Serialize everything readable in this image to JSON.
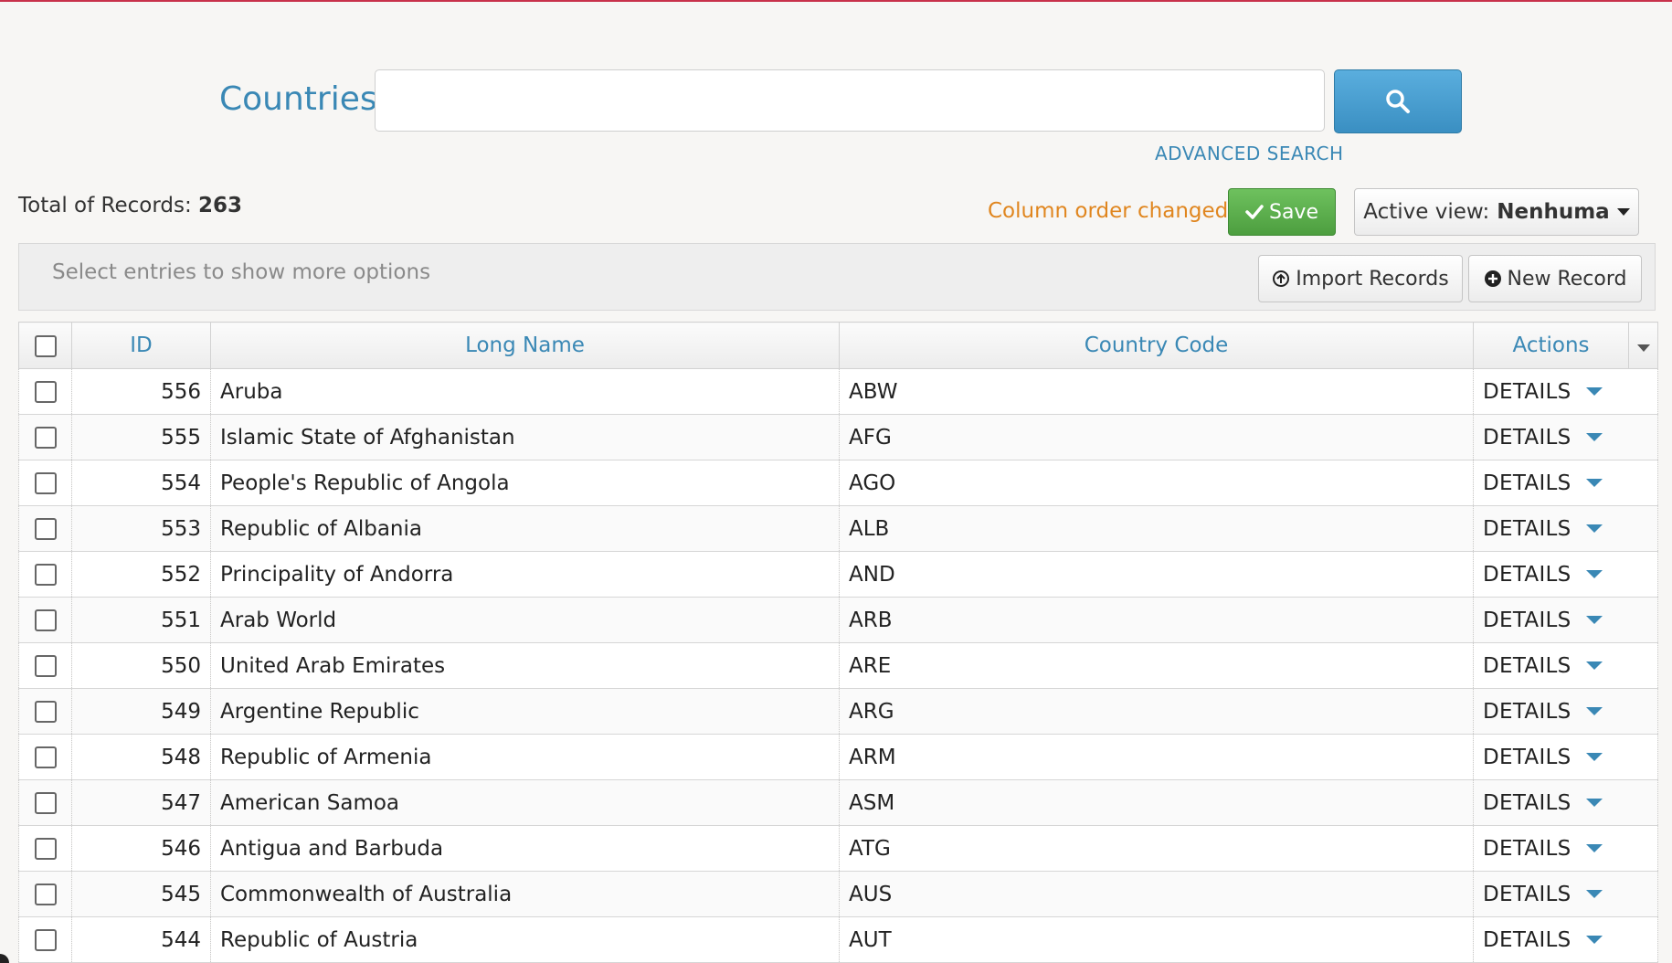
{
  "search": {
    "title": "Countries",
    "value": "",
    "placeholder": "",
    "advanced_label": "ADVANCED SEARCH"
  },
  "summary": {
    "total_label": "Total of Records:",
    "total_value": "263",
    "column_order_notice": "Column order changed",
    "save_label": "Save",
    "active_view_label": "Active view:",
    "active_view_name": "Nenhuma"
  },
  "options": {
    "hint": "Select entries to show more options",
    "import_label": "Import Records",
    "new_label": "New Record"
  },
  "table": {
    "columns": [
      "ID",
      "Long Name",
      "Country Code",
      "Actions"
    ],
    "action_label": "DETAILS",
    "rows": [
      {
        "id": "556",
        "long_name": "Aruba",
        "code": "ABW"
      },
      {
        "id": "555",
        "long_name": "Islamic State of Afghanistan",
        "code": "AFG"
      },
      {
        "id": "554",
        "long_name": "People's Republic of Angola",
        "code": "AGO"
      },
      {
        "id": "553",
        "long_name": "Republic of Albania",
        "code": "ALB"
      },
      {
        "id": "552",
        "long_name": "Principality of Andorra",
        "code": "AND"
      },
      {
        "id": "551",
        "long_name": "Arab World",
        "code": "ARB"
      },
      {
        "id": "550",
        "long_name": "United Arab Emirates",
        "code": "ARE"
      },
      {
        "id": "549",
        "long_name": "Argentine Republic",
        "code": "ARG"
      },
      {
        "id": "548",
        "long_name": "Republic of Armenia",
        "code": "ARM"
      },
      {
        "id": "547",
        "long_name": "American Samoa",
        "code": "ASM"
      },
      {
        "id": "546",
        "long_name": "Antigua and Barbuda",
        "code": "ATG"
      },
      {
        "id": "545",
        "long_name": "Commonwealth of Australia",
        "code": "AUS"
      },
      {
        "id": "544",
        "long_name": "Republic of Austria",
        "code": "AUT"
      }
    ]
  },
  "colors": {
    "accent": "#3a88b5",
    "save_green": "#5cb04d",
    "notice_orange": "#e0861f",
    "top_rule": "#c8314b"
  },
  "icons": {
    "search": "search-icon",
    "save": "check-icon",
    "import": "upload-circle-icon",
    "new": "plus-circle-icon",
    "view_dropdown": "caret-down-icon",
    "row_action": "caret-down-icon"
  }
}
